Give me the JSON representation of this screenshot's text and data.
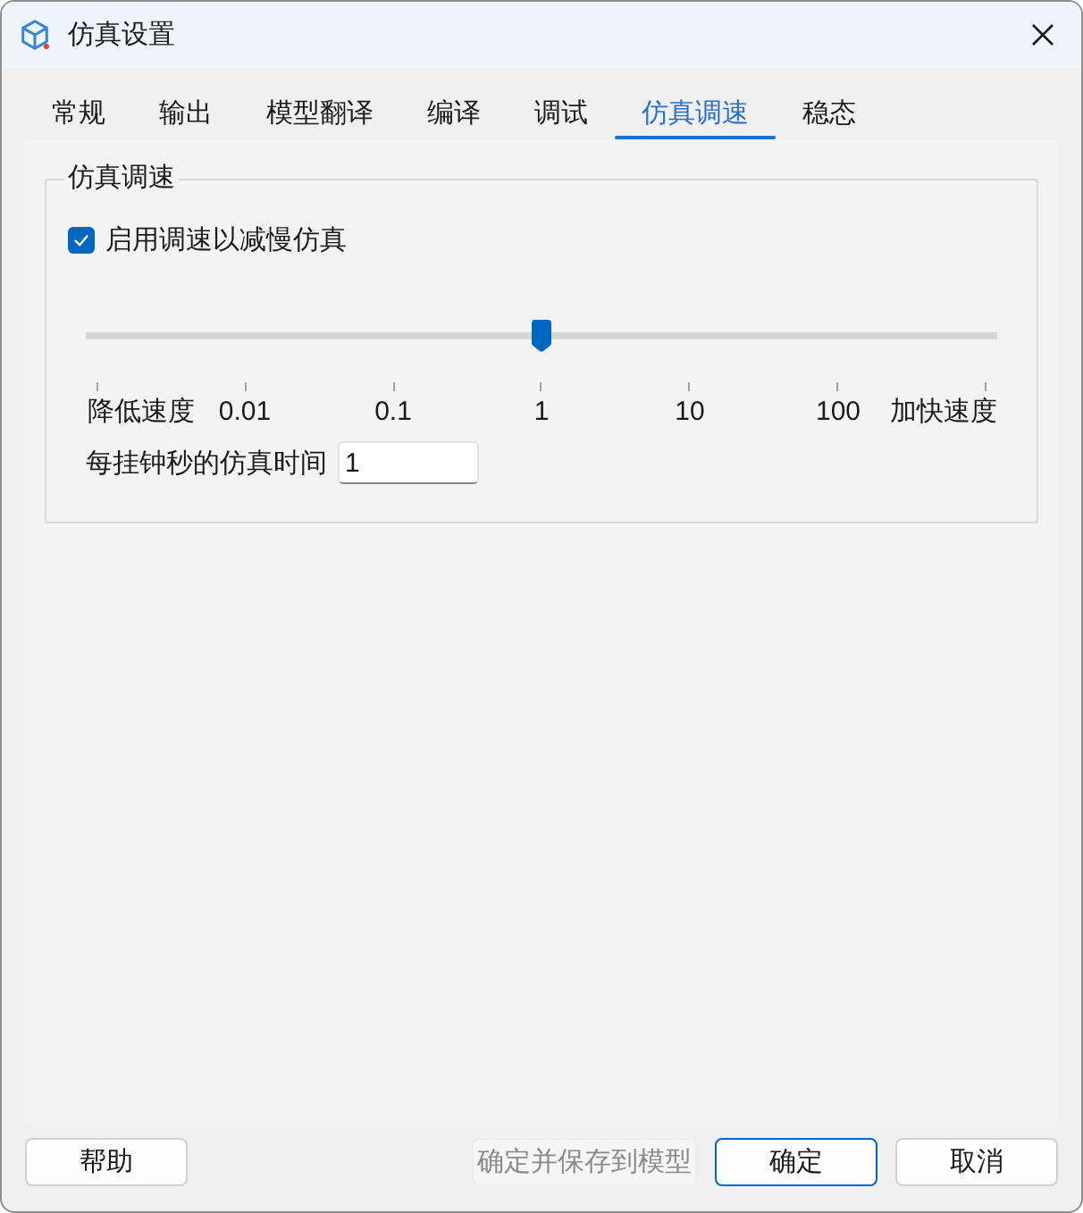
{
  "window": {
    "title": "仿真设置"
  },
  "tabs": [
    {
      "label": "常规",
      "selected": false
    },
    {
      "label": "输出",
      "selected": false
    },
    {
      "label": "模型翻译",
      "selected": false
    },
    {
      "label": "编译",
      "selected": false
    },
    {
      "label": "调试",
      "selected": false
    },
    {
      "label": "仿真调速",
      "selected": true
    },
    {
      "label": "稳态",
      "selected": false
    }
  ],
  "group": {
    "title": "仿真调速",
    "enable_checkbox": {
      "label": "启用调速以减慢仿真",
      "checked": true
    },
    "slider": {
      "level": 0.5,
      "min_label": "降低速度",
      "tick_labels": [
        "0.01",
        "0.1",
        "1",
        "10",
        "100"
      ],
      "max_label": "加快速度"
    },
    "sim_time_field": {
      "label": "每挂钟秒的仿真时间",
      "value": "1"
    }
  },
  "footer": {
    "left_buttons": [
      {
        "label": "帮助",
        "disabled": false,
        "default": false
      }
    ],
    "right_buttons": [
      {
        "label": "确定并保存到模型",
        "disabled": true,
        "default": false
      },
      {
        "label": "确定",
        "disabled": false,
        "default": true
      },
      {
        "label": "取消",
        "disabled": false,
        "default": false
      }
    ]
  }
}
